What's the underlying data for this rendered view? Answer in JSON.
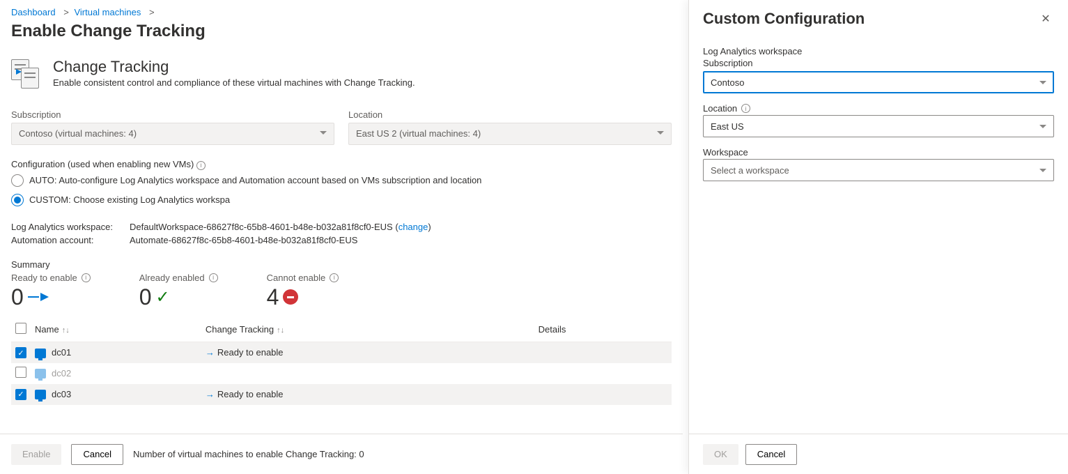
{
  "breadcrumb": {
    "items": [
      "Dashboard",
      "Virtual machines"
    ],
    "sep": ">"
  },
  "page_title": "Enable Change Tracking",
  "ct_header": {
    "title": "Change Tracking",
    "subtitle": "Enable consistent control and compliance of these virtual machines with Change Tracking."
  },
  "filters": {
    "subscription_label": "Subscription",
    "subscription_value": "Contoso (virtual machines: 4)",
    "location_label": "Location",
    "location_value": "East US 2 (virtual machines: 4)"
  },
  "configuration": {
    "label": "Configuration (used when enabling new VMs)",
    "auto_label": "AUTO: Auto-configure Log Analytics workspace and Automation account based on VMs subscription and location",
    "custom_label": "CUSTOM: Choose existing Log Analytics workspa",
    "selected": "custom"
  },
  "info": {
    "workspace_key": "Log Analytics workspace:",
    "workspace_value": "DefaultWorkspace-68627f8c-65b8-4601-b48e-b032a81f8cf0-EUS",
    "workspace_change": "change",
    "automation_key": "Automation account:",
    "automation_value": "Automate-68627f8c-65b8-4601-b48e-b032a81f8cf0-EUS"
  },
  "summary": {
    "label": "Summary",
    "ready_label": "Ready to enable",
    "ready_value": "0",
    "already_label": "Already enabled",
    "already_value": "0",
    "cannot_label": "Cannot enable",
    "cannot_value": "4"
  },
  "table": {
    "col_name": "Name",
    "col_ct": "Change Tracking",
    "col_details": "Details",
    "rows": [
      {
        "name": "dc01",
        "change_tracking": "Ready to enable",
        "checked": true,
        "enabled": true
      },
      {
        "name": "dc02",
        "change_tracking": "",
        "checked": false,
        "enabled": false
      },
      {
        "name": "dc03",
        "change_tracking": "Ready to enable",
        "checked": true,
        "enabled": true
      }
    ]
  },
  "footer": {
    "enable": "Enable",
    "cancel": "Cancel",
    "status": "Number of virtual machines to enable Change Tracking: 0"
  },
  "panel": {
    "title": "Custom Configuration",
    "la_label": "Log Analytics workspace",
    "sub_label": "Subscription",
    "sub_value": "Contoso",
    "loc_label": "Location",
    "loc_value": "East US",
    "ws_label": "Workspace",
    "ws_placeholder": "Select a workspace",
    "ok": "OK",
    "cancel": "Cancel"
  }
}
